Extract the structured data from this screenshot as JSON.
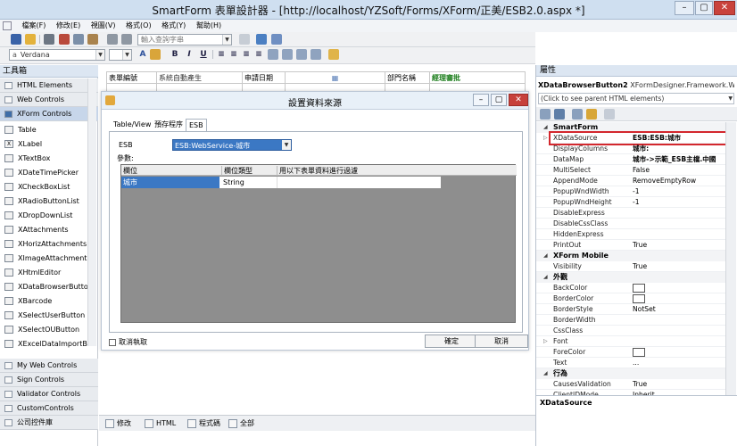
{
  "window": {
    "title": "SmartForm 表單設計器 - [http://localhost/YZSoft/Forms/XForm/正美/ESB2.0.aspx *]"
  },
  "menu": [
    "檔案(F)",
    "修改(E)",
    "視圖(V)",
    "格式(O)",
    "格式(Y)",
    "幫助(H)"
  ],
  "toolbar": {
    "query_placeholder": "輸入查詢字串",
    "font": "Verdana",
    "letter_a": "a",
    "bold": "B",
    "italic": "I",
    "underline": "U"
  },
  "toolbox": {
    "title": "工具箱",
    "categories_top": [
      "HTML Elements",
      "Web Controls",
      "XForm Controls"
    ],
    "items": [
      "Table",
      "XLabel",
      "XTextBox",
      "XDateTimePicker",
      "XCheckBoxList",
      "XRadioButtonList",
      "XDropDownList",
      "XAttachments",
      "XHorizAttachments",
      "XImageAttachment",
      "XHtmlEditor",
      "XDataBrowserButton",
      "XBarcode",
      "XSelectUserButton",
      "XSelectOUButton",
      "XExcelDataImportB..."
    ],
    "categories_bottom": [
      "My Web Controls",
      "Sign Controls",
      "Validator Controls",
      "CustomControls",
      "公司控件庫"
    ]
  },
  "designer": {
    "row1": [
      "表單編號",
      "系統自動產生",
      "申請日期",
      "",
      "部門名稱",
      "經理審批"
    ]
  },
  "bottom_tabs": [
    "修改",
    "HTML",
    "程式碼",
    "全部"
  ],
  "dialog": {
    "title": "設置資料來源",
    "tabs": [
      "Table/View",
      "預存程序",
      "ESB"
    ],
    "esb_label": "ESB",
    "esb_value": "ESB:WebService-城市",
    "params_label": "參數:",
    "columns": [
      "欄位",
      "欄位類型",
      "用以下表單資料進行過濾"
    ],
    "rows": [
      [
        "城市",
        "String",
        ""
      ]
    ],
    "cancel_run": "取消執取",
    "ok": "確定",
    "cancel": "取消"
  },
  "props": {
    "title": "屬性",
    "object": "XDataBrowserButton2",
    "object_type": "XFormDesigner.Framework.We",
    "parent_hint": "(Click to see parent HTML elements)",
    "rows": [
      {
        "cat": "SmartForm"
      },
      {
        "n": "XDataSource",
        "v": "ESB:ESB:城市",
        "hl": true,
        "exp": true
      },
      {
        "n": "DisplayColumns",
        "v": "城市:"
      },
      {
        "n": "DataMap",
        "v": "城市->示範_ESB主檔.中國"
      },
      {
        "n": "MultiSelect",
        "v": "False"
      },
      {
        "n": "AppendMode",
        "v": "RemoveEmptyRow"
      },
      {
        "n": "PopupWndWidth",
        "v": "-1"
      },
      {
        "n": "PopupWndHeight",
        "v": "-1"
      },
      {
        "n": "DisableExpress",
        "v": ""
      },
      {
        "n": "DisableCssClass",
        "v": ""
      },
      {
        "n": "HiddenExpress",
        "v": ""
      },
      {
        "n": "PrintOut",
        "v": "True"
      },
      {
        "cat": "XForm Mobile"
      },
      {
        "n": "Visibility",
        "v": "True"
      },
      {
        "cat": "外觀"
      },
      {
        "n": "BackColor",
        "v": "",
        "color": true
      },
      {
        "n": "BorderColor",
        "v": "",
        "color": true
      },
      {
        "n": "BorderStyle",
        "v": "NotSet"
      },
      {
        "n": "BorderWidth",
        "v": ""
      },
      {
        "n": "CssClass",
        "v": ""
      },
      {
        "n": "Font",
        "v": "",
        "exp": true
      },
      {
        "n": "ForeColor",
        "v": "",
        "color": true
      },
      {
        "n": "Text",
        "v": "..."
      },
      {
        "cat": "行為"
      },
      {
        "n": "CausesValidation",
        "v": "True"
      },
      {
        "n": "ClientIDMode",
        "v": "Inherit"
      }
    ],
    "footer": "XDataSource"
  }
}
